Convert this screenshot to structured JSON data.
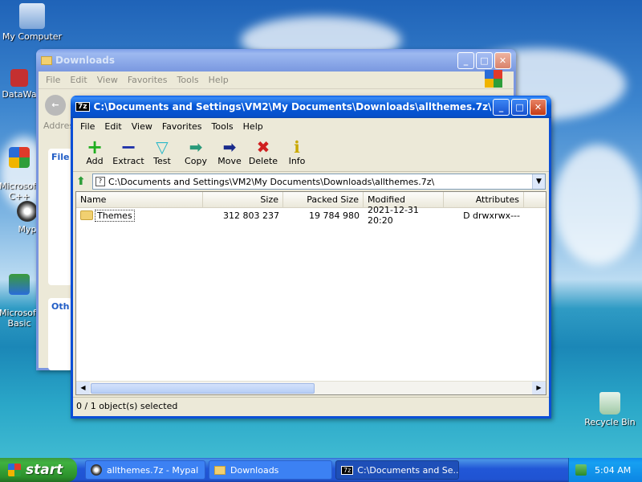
{
  "desktop": {
    "icons": [
      {
        "label": "My Computer"
      },
      {
        "label": "DataWa"
      },
      {
        "label": "Microsoft\nC++"
      },
      {
        "label": "Myp"
      },
      {
        "label": "Microsoft\nBasic"
      },
      {
        "label": "Recycle Bin"
      }
    ]
  },
  "explorer": {
    "title": "Downloads",
    "menu": [
      "File",
      "Edit",
      "View",
      "Favorites",
      "Tools",
      "Help"
    ],
    "address_label": "Addres",
    "side_fragments": [
      "File",
      "Oth"
    ]
  },
  "sevenzip": {
    "title": "C:\\Documents and Settings\\VM2\\My Documents\\Downloads\\allthemes.7z\\",
    "menu": [
      "File",
      "Edit",
      "View",
      "Favorites",
      "Tools",
      "Help"
    ],
    "toolbar": [
      {
        "label": "Add",
        "icon": "plus-icon"
      },
      {
        "label": "Extract",
        "icon": "minus-icon"
      },
      {
        "label": "Test",
        "icon": "check-arrow-icon"
      },
      {
        "label": "Copy",
        "icon": "copy-arrow-icon"
      },
      {
        "label": "Move",
        "icon": "move-arrow-icon"
      },
      {
        "label": "Delete",
        "icon": "delete-x-icon"
      },
      {
        "label": "Info",
        "icon": "info-icon"
      }
    ],
    "address": "C:\\Documents and Settings\\VM2\\My Documents\\Downloads\\allthemes.7z\\",
    "columns": {
      "name": "Name",
      "size": "Size",
      "packed": "Packed Size",
      "modified": "Modified",
      "attributes": "Attributes"
    },
    "rows": [
      {
        "name": "Themes",
        "size": "312 803 237",
        "packed": "19 784 980",
        "modified": "2021-12-31 20:20",
        "attributes": "D drwxrwx---"
      }
    ],
    "status": "0 / 1 object(s) selected"
  },
  "taskbar": {
    "start": "start",
    "tasks": [
      {
        "label": "allthemes.7z - Mypal"
      },
      {
        "label": "Downloads"
      },
      {
        "label": "C:\\Documents and Se..."
      }
    ],
    "clock": "5:04 AM"
  },
  "colors": {
    "xp_blue": "#0758d6",
    "taskbar": "#2157d7",
    "start_green": "#3fb13f"
  }
}
